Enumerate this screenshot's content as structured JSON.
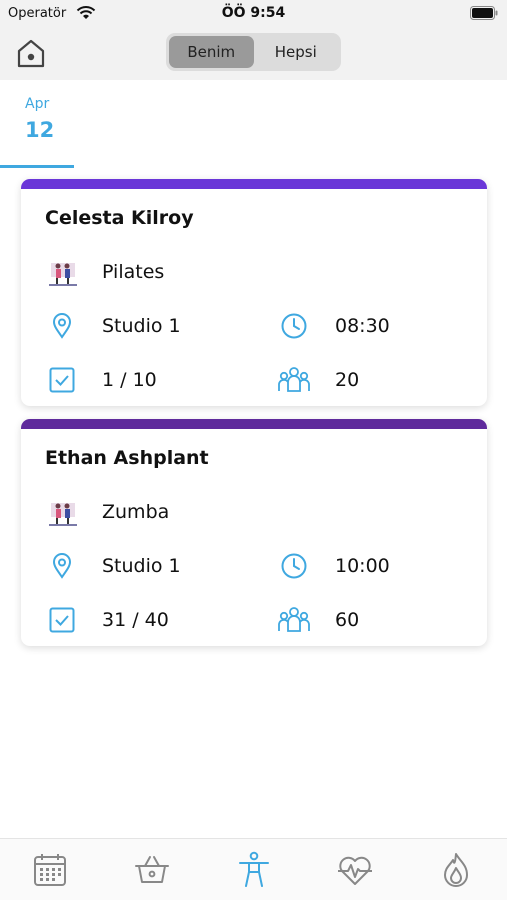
{
  "status_bar": {
    "carrier": "Operatör",
    "time": "ÖÖ 9:54"
  },
  "header": {
    "segments": [
      {
        "label": "Benim",
        "active": true
      },
      {
        "label": "Hepsi",
        "active": false
      }
    ]
  },
  "date_tab": {
    "month": "Apr",
    "day": "12"
  },
  "sessions": [
    {
      "instructor": "Celesta Kilroy",
      "class_name": "Pilates",
      "location": "Studio 1",
      "time": "08:30",
      "booked": "1 / 10",
      "capacity": "20",
      "accent_color": "#6a36d8"
    },
    {
      "instructor": "Ethan Ashplant",
      "class_name": "Zumba",
      "location": "Studio 1",
      "time": "10:00",
      "booked": "31 / 40",
      "capacity": "60",
      "accent_color": "#5f2a9c"
    }
  ],
  "tab_bar": {
    "items": [
      {
        "icon": "calendar-icon",
        "active": false
      },
      {
        "icon": "basket-icon",
        "active": false
      },
      {
        "icon": "person-icon",
        "active": true
      },
      {
        "icon": "heart-pulse-icon",
        "active": false
      },
      {
        "icon": "flame-icon",
        "active": false
      }
    ]
  },
  "colors": {
    "accent": "#3fa8e0",
    "icon_gray": "#888888"
  }
}
